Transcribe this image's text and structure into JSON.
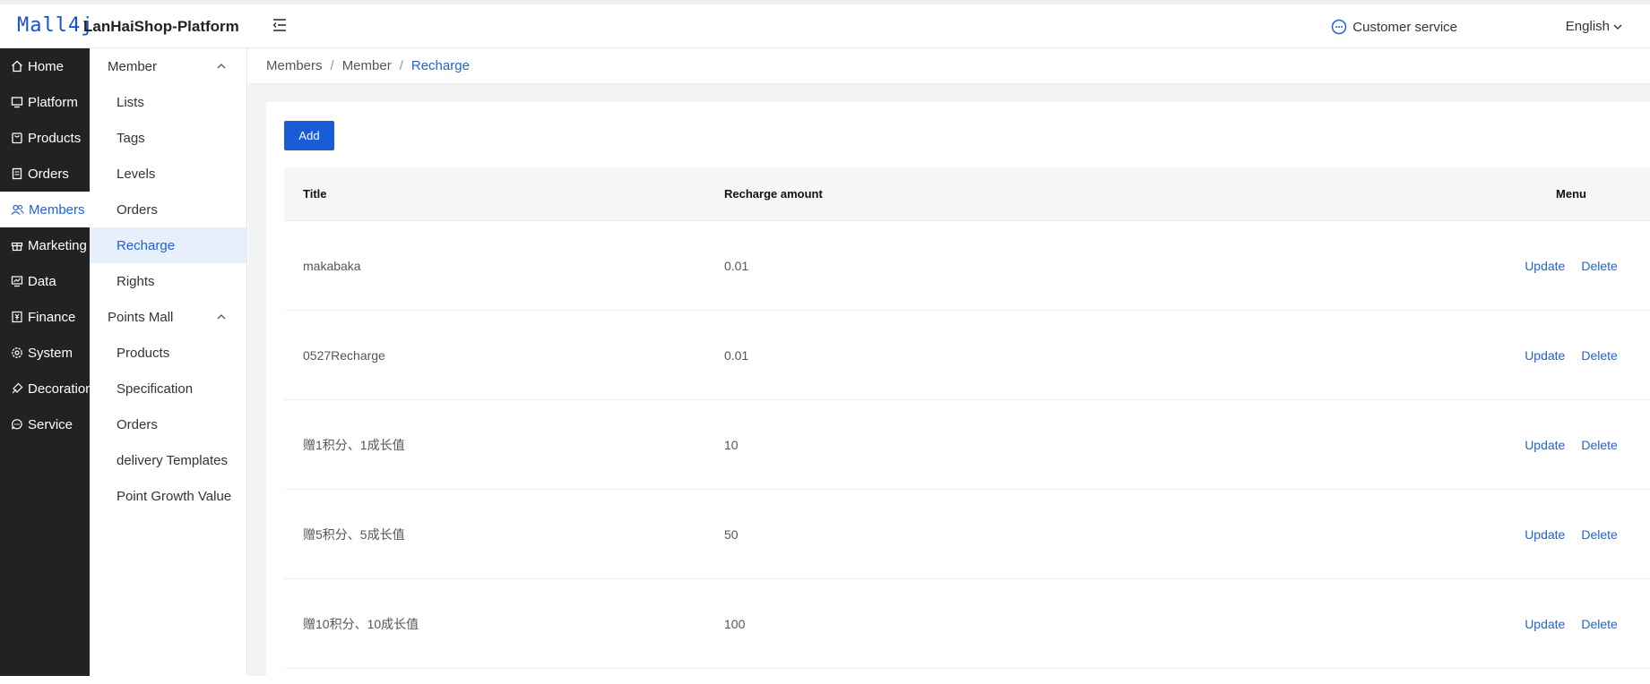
{
  "header": {
    "logo": "Mall4j",
    "platform_name": "LanHaiShop-Platform",
    "customer_service": "Customer service",
    "language": "English"
  },
  "sidebar": {
    "items": [
      {
        "label": "Home",
        "icon": "home-icon"
      },
      {
        "label": "Platform",
        "icon": "monitor-icon"
      },
      {
        "label": "Products",
        "icon": "bag-icon"
      },
      {
        "label": "Orders",
        "icon": "document-icon"
      },
      {
        "label": "Members",
        "icon": "users-icon",
        "active": true
      },
      {
        "label": "Marketing",
        "icon": "gift-icon"
      },
      {
        "label": "Data",
        "icon": "chart-board-icon"
      },
      {
        "label": "Finance",
        "icon": "finance-icon"
      },
      {
        "label": "System",
        "icon": "gear-icon"
      },
      {
        "label": "Decoration",
        "icon": "brush-icon"
      },
      {
        "label": "Service",
        "icon": "chat-icon"
      }
    ]
  },
  "submenu": {
    "group1": "Member",
    "group1_items": [
      "Lists",
      "Tags",
      "Levels",
      "Orders",
      "Recharge",
      "Rights"
    ],
    "group2": "Points Mall",
    "group2_items": [
      "Products",
      "Specification",
      "Orders",
      "delivery Templates",
      "Point Growth Value"
    ]
  },
  "breadcrumb": [
    "Members",
    "Member",
    "Recharge"
  ],
  "toolbar": {
    "add_label": "Add"
  },
  "table": {
    "columns": [
      "Title",
      "Recharge amount",
      "Menu"
    ],
    "rows": [
      {
        "title": "makabaka",
        "amount": "0.01"
      },
      {
        "title": "0527Recharge",
        "amount": "0.01"
      },
      {
        "title": "赠1积分、1成长值",
        "amount": "10"
      },
      {
        "title": "赠5积分、5成长值",
        "amount": "50"
      },
      {
        "title": "赠10积分、10成长值",
        "amount": "100"
      }
    ],
    "update_label": "Update",
    "delete_label": "Delete"
  },
  "colors": {
    "accent": "#1f63d8",
    "sidebar_bg": "#222222",
    "button": "#1a5bd6"
  }
}
